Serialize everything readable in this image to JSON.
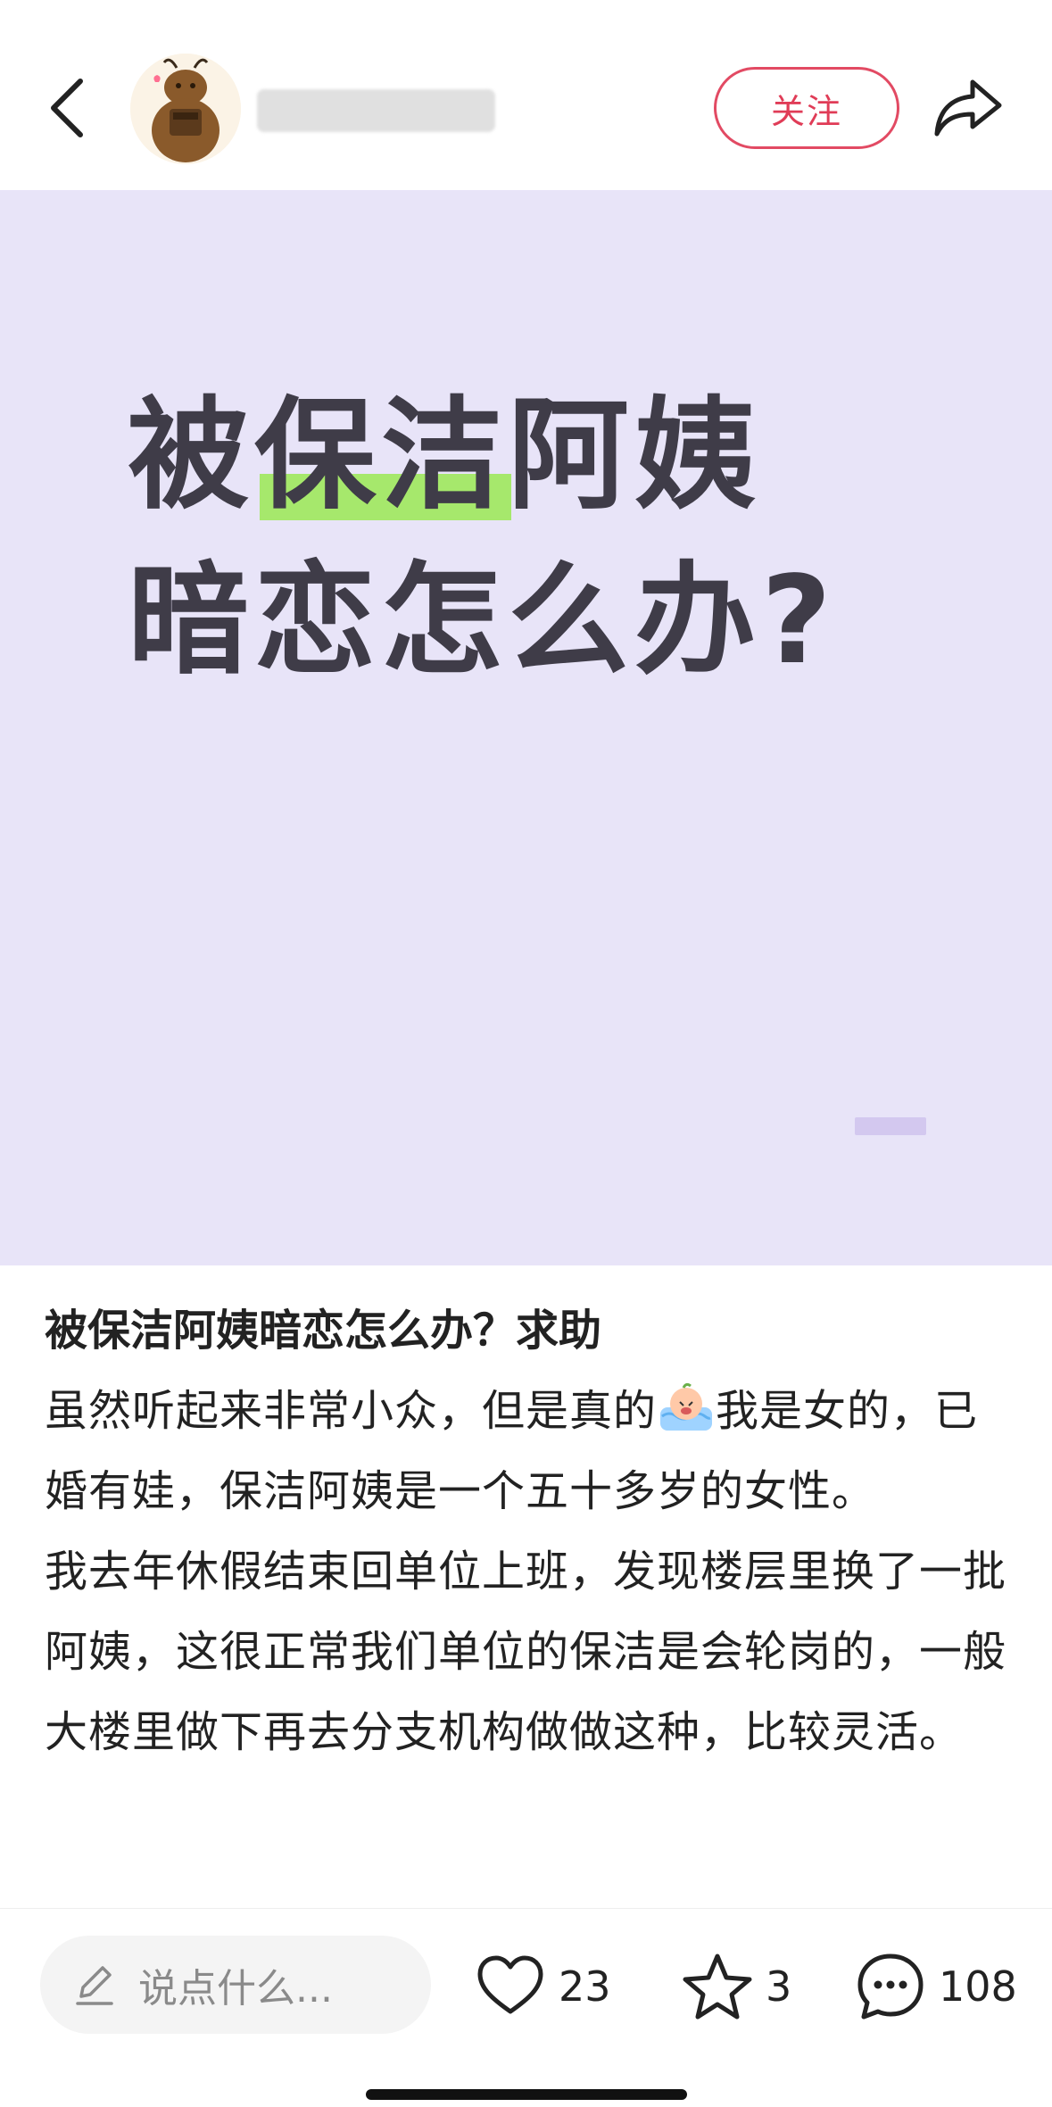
{
  "header": {
    "back_icon": "chevron-left-icon",
    "avatar_icon": "bear-avatar-icon",
    "follow_label": "关注",
    "share_icon": "share-arrow-icon"
  },
  "cover": {
    "line1": "被保洁阿姨",
    "line2": "暗恋怎么办?",
    "background_color": "#e8e4f8",
    "highlight_color": "#a6e86c"
  },
  "post": {
    "title": "被保洁阿姨暗恋怎么办？求助",
    "body_before_emoji": "虽然听起来非常小众，但是真的",
    "emoji_icon": "crying-emoji-icon",
    "body_after_emoji": "我是女的，已婚有娃，保洁阿姨是一个五十多岁的女性。",
    "paragraph2": "我去年休假结束回单位上班，发现楼层里换了一批阿姨，这很正常我们单位的保洁是会轮岗的，一般大楼里做下再去分支机构做做这种，比较灵活。"
  },
  "bottom_bar": {
    "comment_placeholder": "说点什么...",
    "likes": "23",
    "stars": "3",
    "comments": "108",
    "accent_color": "#e24a63"
  }
}
